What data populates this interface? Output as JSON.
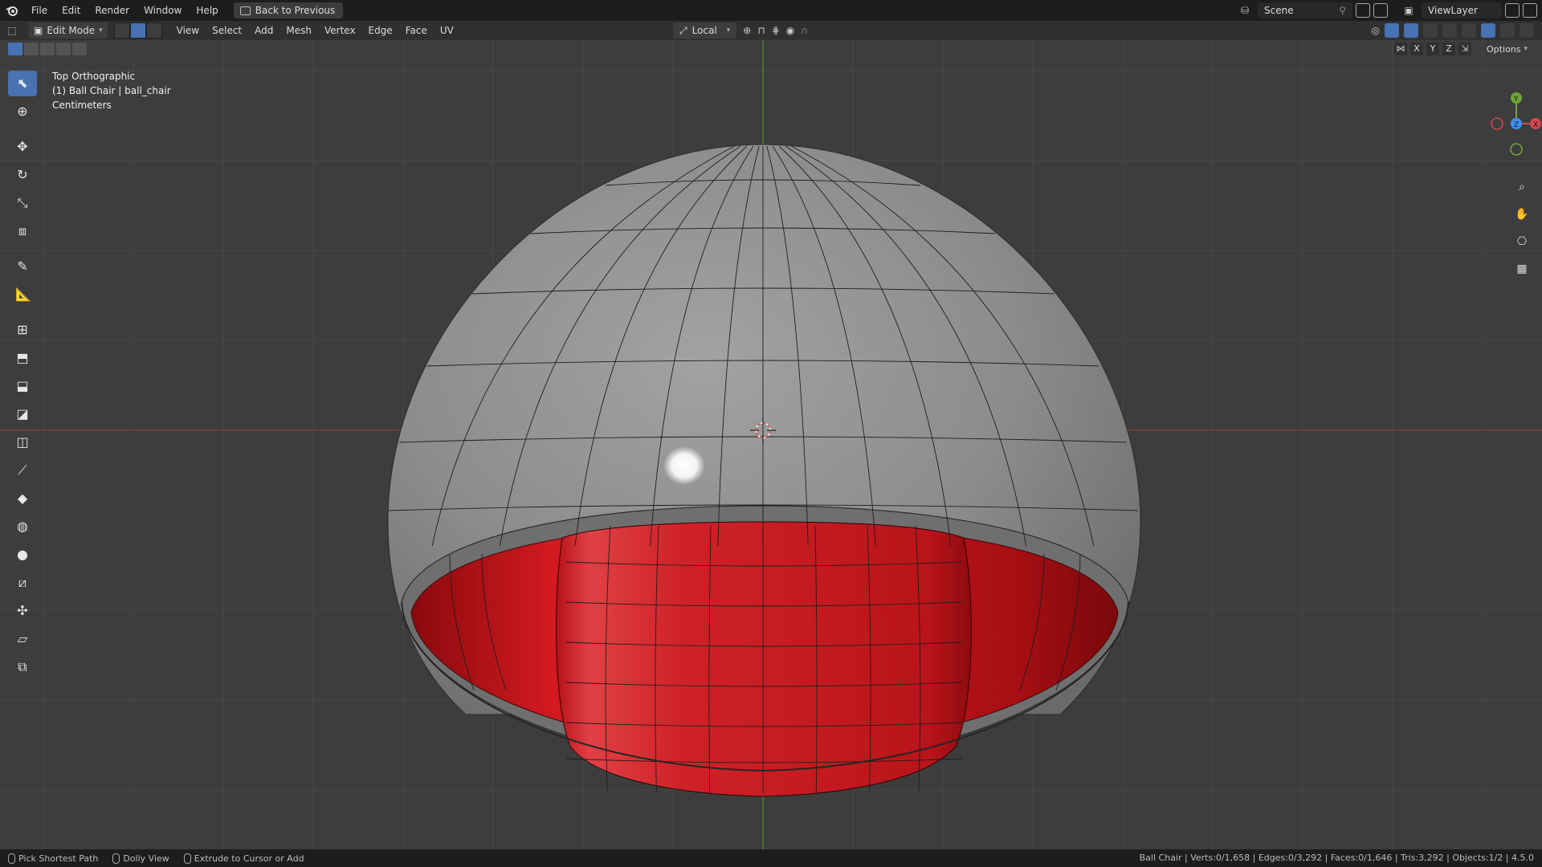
{
  "menu": {
    "items": [
      "File",
      "Edit",
      "Render",
      "Window",
      "Help"
    ],
    "back_button": "Back to Previous",
    "scene": "Scene",
    "view_layer": "ViewLayer"
  },
  "header": {
    "mode": "Edit Mode",
    "menus": [
      "View",
      "Select",
      "Add",
      "Mesh",
      "Vertex",
      "Edge",
      "Face",
      "UV"
    ],
    "transform_orientation": "Local"
  },
  "tool_header": {
    "axis_labels": [
      "X",
      "Y",
      "Z"
    ],
    "options_label": "Options"
  },
  "viewport": {
    "view_name": "Top Orthographic",
    "object_info": "(1) Ball Chair | ball_chair",
    "units": "Centimeters",
    "mesh_colors": {
      "shell": "#8e8e8e",
      "inner": "#c2151a"
    }
  },
  "toolbar": {
    "tools": [
      "select-box",
      "cursor",
      "move",
      "rotate",
      "scale",
      "transform",
      "annotate",
      "measure",
      "add-cube",
      "extrude-region",
      "inset-faces",
      "bevel",
      "loop-cut",
      "knife",
      "poly-build",
      "spin",
      "smooth",
      "edge-slide",
      "shrink-fatten",
      "shear",
      "rip-region"
    ]
  },
  "status": {
    "hints": [
      "Pick Shortest Path",
      "Dolly View",
      "Extrude to Cursor or Add"
    ],
    "stats": "Ball Chair | Verts:0/1,658 | Edges:0/3,292 | Faces:0/1,646 | Tris:3,292 | Objects:1/2 | 4.5.0"
  }
}
